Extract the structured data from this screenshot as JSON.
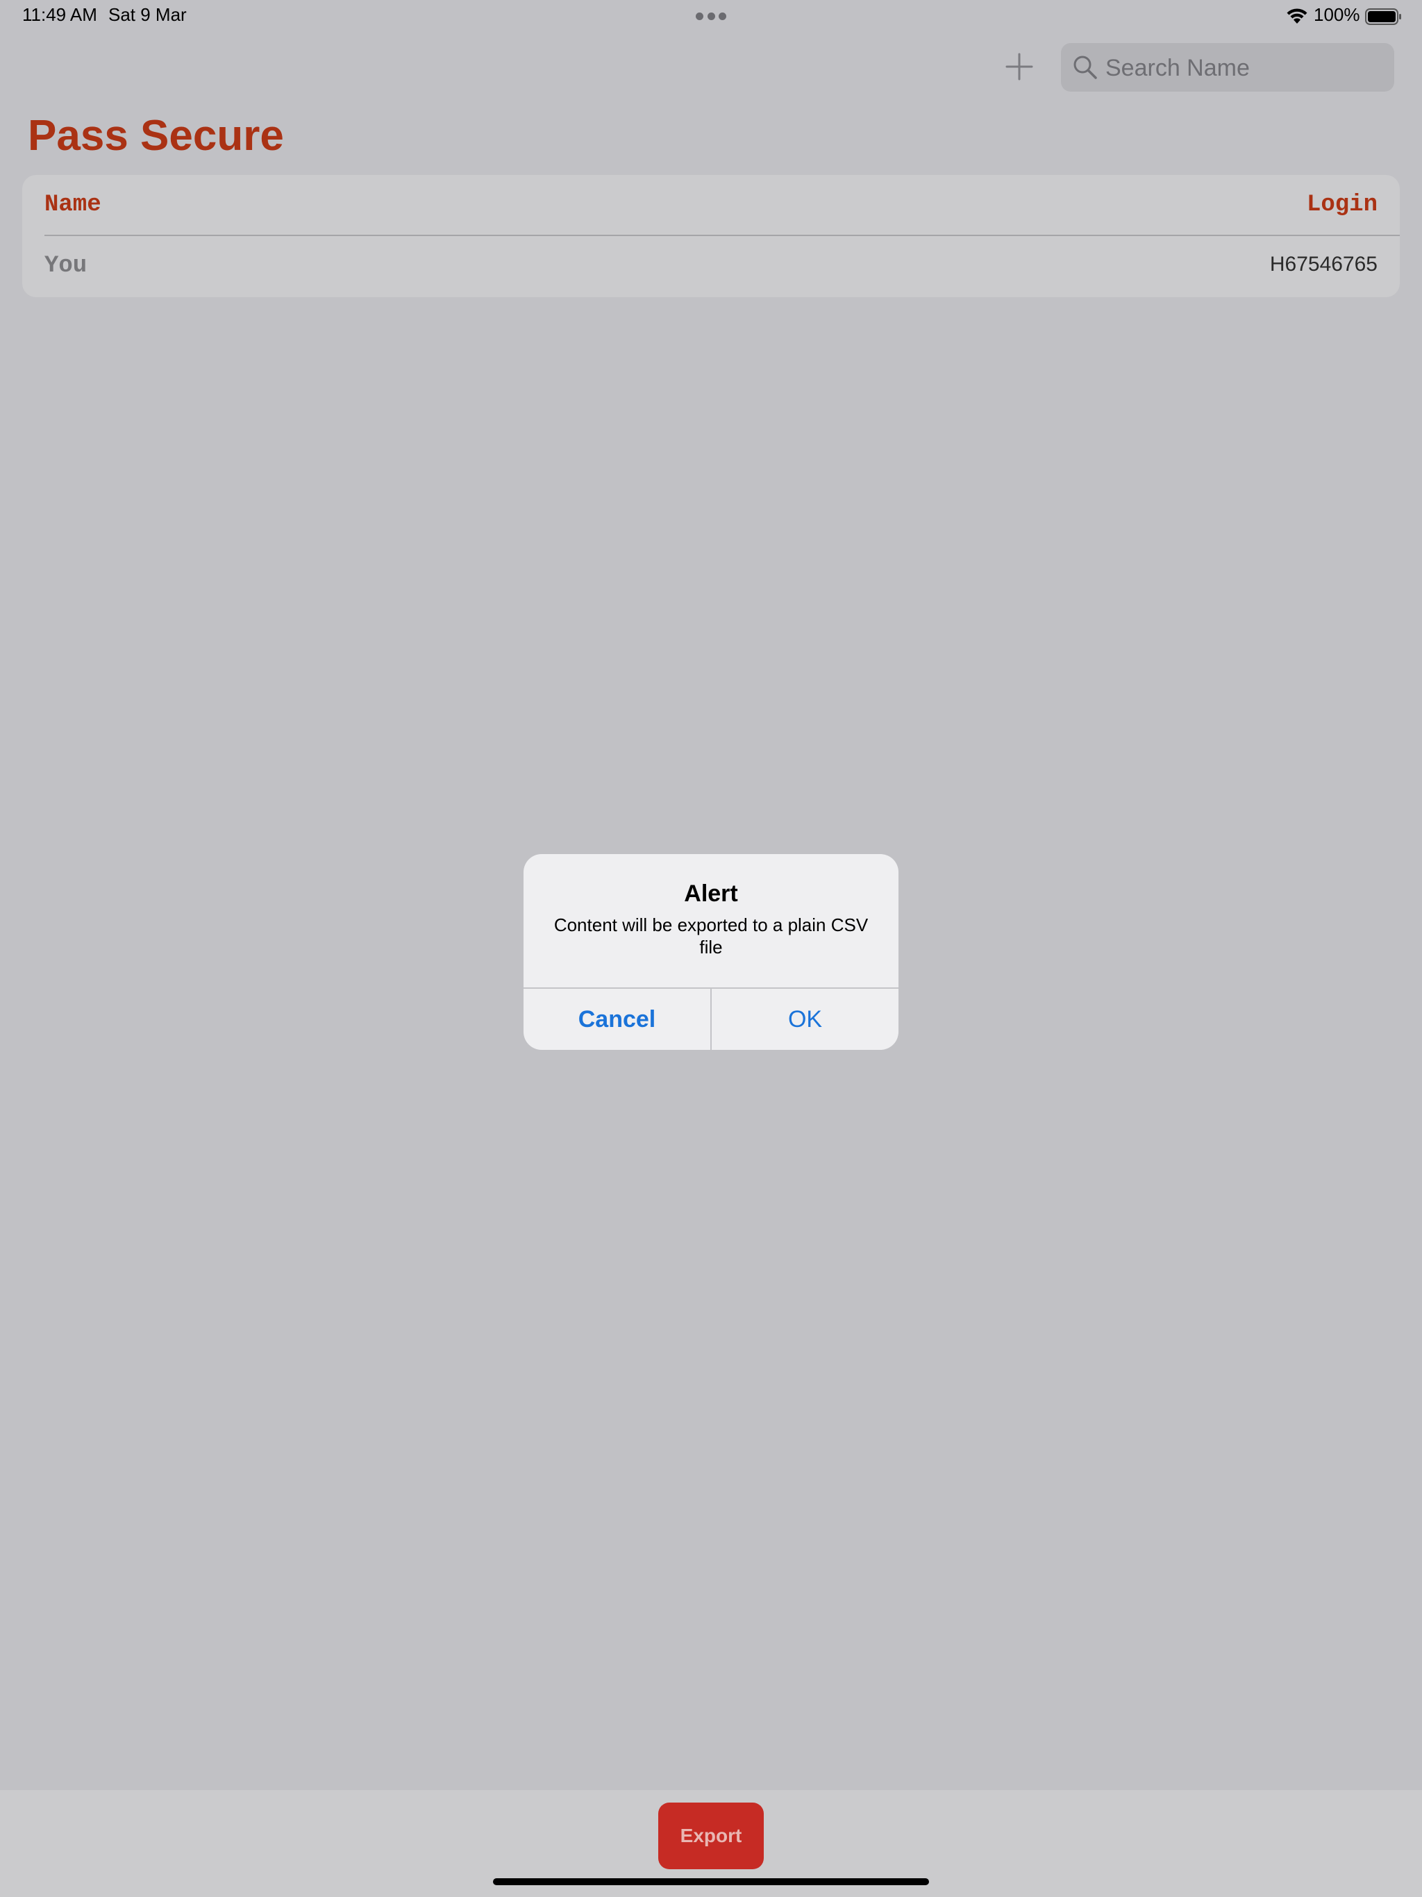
{
  "status_bar": {
    "time": "11:49 AM",
    "date": "Sat 9 Mar",
    "battery": "100%",
    "icons": [
      "multitask-dots-icon",
      "wifi-icon",
      "battery-icon"
    ]
  },
  "nav": {
    "add_icon": "plus-icon",
    "search": {
      "icon": "search-icon",
      "placeholder": "Search Name",
      "value": ""
    }
  },
  "page": {
    "title": "Pass Secure"
  },
  "table": {
    "headers": {
      "name": "Name",
      "login": "Login"
    },
    "rows": [
      {
        "name": "You",
        "login": "H67546765"
      }
    ]
  },
  "alert": {
    "title": "Alert",
    "message": "Content will be exported to a plain CSV file",
    "cancel_label": "Cancel",
    "ok_label": "OK"
  },
  "toolbar": {
    "export_label": "Export"
  },
  "colors": {
    "accent": "#aa3214",
    "export_button": "#c62b24",
    "alert_action": "#1a73d9",
    "background_dimmed": "#c1c1c5"
  }
}
